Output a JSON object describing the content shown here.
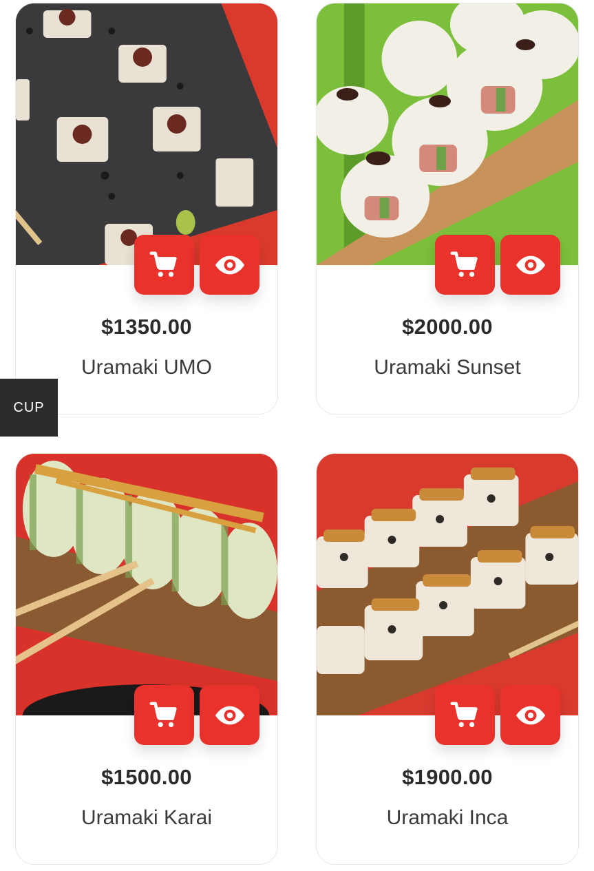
{
  "colors": {
    "accent": "#e8322b",
    "side_tab_bg": "#2c2c2c"
  },
  "side_tab": {
    "label": "CUP"
  },
  "products": [
    {
      "name": "Uramaki UMO",
      "price": "$1350.00",
      "cart_icon": "cart-icon",
      "view_icon": "eye-icon"
    },
    {
      "name": "Uramaki Sunset",
      "price": "$2000.00",
      "cart_icon": "cart-icon",
      "view_icon": "eye-icon"
    },
    {
      "name": "Uramaki Karai",
      "price": "$1500.00",
      "cart_icon": "cart-icon",
      "view_icon": "eye-icon"
    },
    {
      "name": "Uramaki Inca",
      "price": "$1900.00",
      "cart_icon": "cart-icon",
      "view_icon": "eye-icon"
    }
  ]
}
